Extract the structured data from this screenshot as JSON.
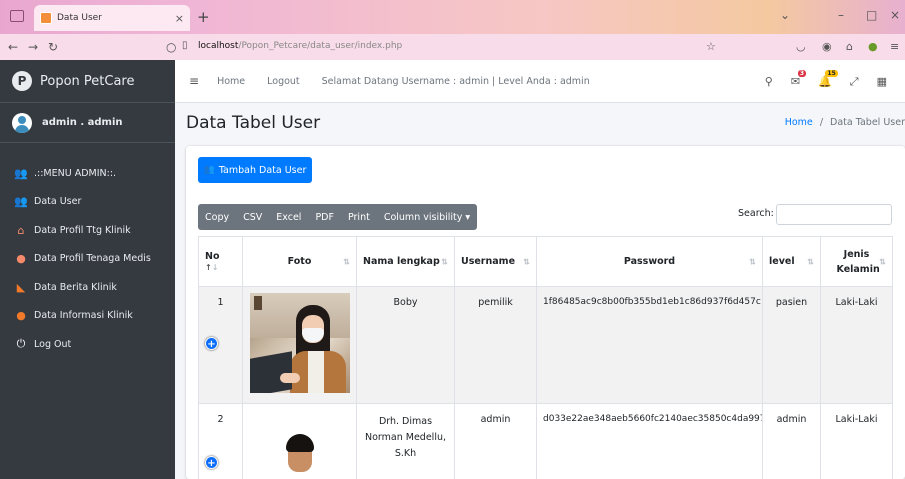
{
  "browser": {
    "tab_title": "Data User",
    "tab_close": "×",
    "new_tab": "+",
    "url_host": "localhost",
    "url_path": "/Popon_Petcare/data_user/index.php"
  },
  "sidebar": {
    "brand_logo_letter": "P",
    "brand": "Popon PetCare",
    "user": "admin . admin",
    "items": [
      {
        "label": ".::MENU ADMIN::.",
        "icon": "users-cog-icon"
      },
      {
        "label": "Data User",
        "icon": "users-icon"
      },
      {
        "label": "Data Profil Ttg Klinik",
        "icon": "home-icon"
      },
      {
        "label": "Data Profil Tenaga Medis",
        "icon": "user-md-icon"
      },
      {
        "label": "Data Berita Klinik",
        "icon": "rss-icon"
      },
      {
        "label": "Data Informasi Klinik",
        "icon": "info-circle-icon"
      },
      {
        "label": "Log Out",
        "icon": "power-icon"
      }
    ]
  },
  "navbar": {
    "home": "Home",
    "logout": "Logout",
    "welcome": "Selamat Datang Username : admin | Level Anda : admin",
    "messages_badge": "3",
    "notifications_badge": "15"
  },
  "header": {
    "title": "Data Tabel User",
    "breadcrumb_home": "Home",
    "breadcrumb_sep": "/",
    "breadcrumb_current": "Data Tabel User"
  },
  "toolbar": {
    "add_button": "Tambah Data User",
    "buttons": [
      "Copy",
      "CSV",
      "Excel",
      "PDF",
      "Print",
      "Column visibility ▾"
    ],
    "search_label": "Search:",
    "search_value": ""
  },
  "table": {
    "headers": [
      "No",
      "Foto",
      "Nama lengkap",
      "Username",
      "Password",
      "level",
      "Jenis Kelamin"
    ],
    "rows": [
      {
        "no": "1",
        "nama": "Boby",
        "username": "pemilik",
        "password": "1f86485ac9c8b00fb355bd1eb1c86d937f6d457c",
        "level": "pasien",
        "jk": "Laki-Laki"
      },
      {
        "no": "2",
        "nama": "Drh. Dimas Norman Medellu, S.Kh",
        "username": "admin",
        "password": "d033e22ae348aeb5660fc2140aec35850c4da997",
        "level": "admin",
        "jk": "Laki-Laki"
      }
    ]
  }
}
